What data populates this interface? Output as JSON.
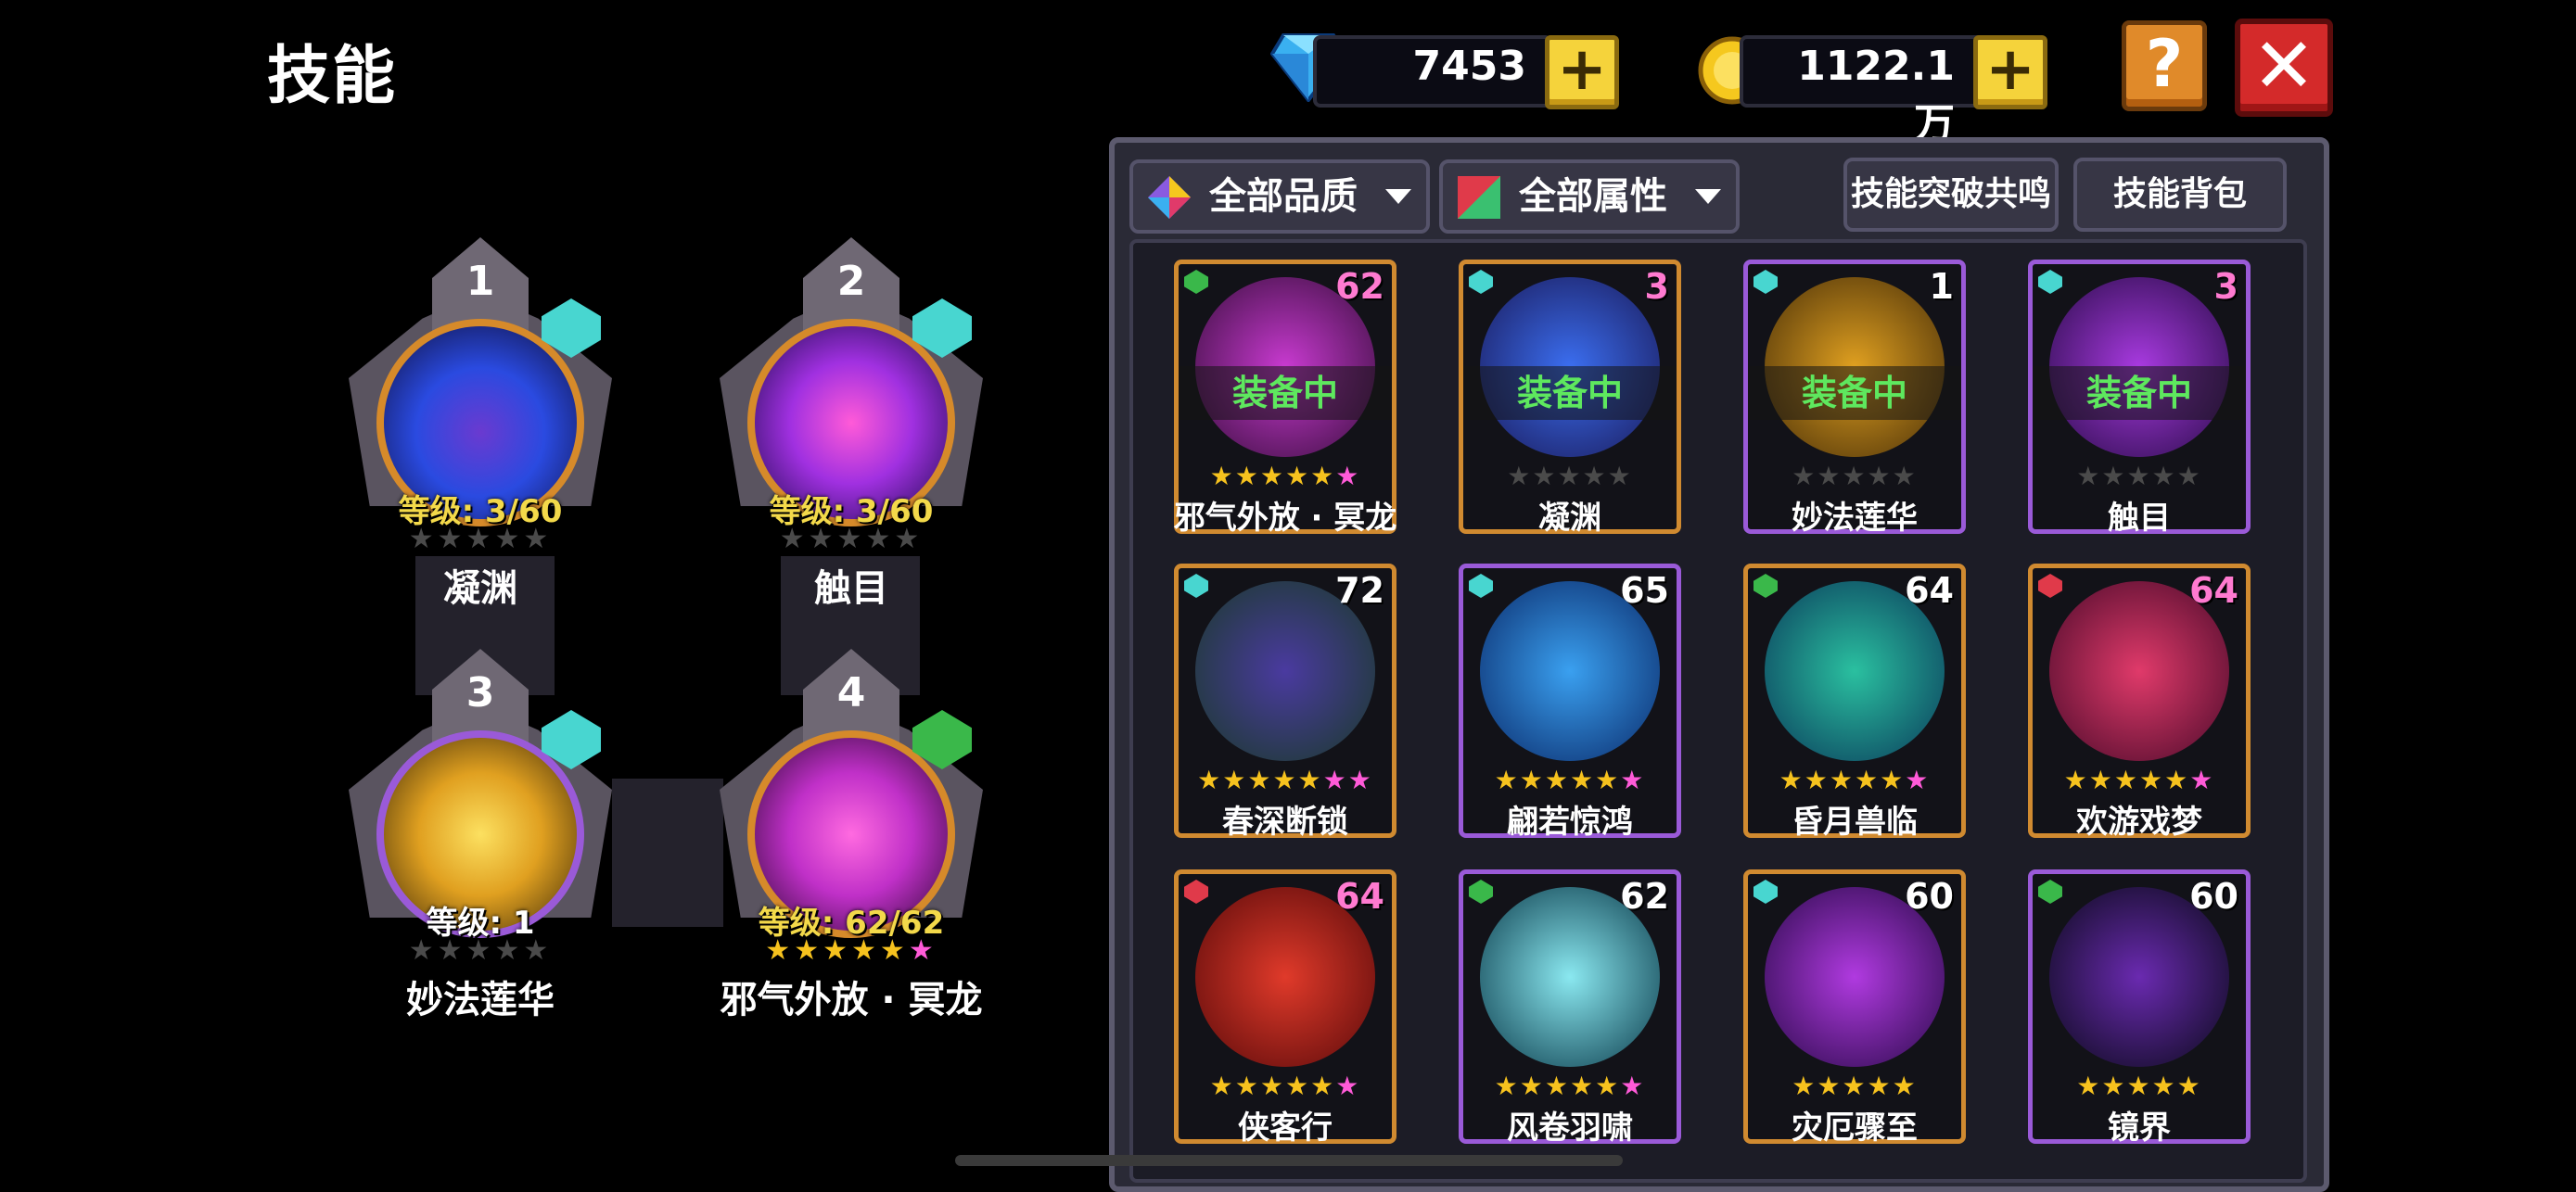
{
  "title": "技能",
  "currency": {
    "gems": "7453",
    "gold": "1122.1万",
    "plus_symbol": "+",
    "help_symbol": "?",
    "close_symbol": "✕"
  },
  "colors": {
    "gold_star": "#f6c21e",
    "pink_star": "#ff5ad8",
    "empty_star": "#4a4a4a",
    "equipped_text": "#5ee85e",
    "level_text": "#f3d94a",
    "orange_frame": "#d08a30",
    "purple_frame": "#9a5ad8"
  },
  "equipped": [
    {
      "slot": "1",
      "level": "等级: 3/60",
      "stars_gold": 0,
      "stars_pink": 0,
      "stars_total": 5,
      "name": "凝渊",
      "gem": "cyan",
      "orb": "blue-demon"
    },
    {
      "slot": "2",
      "level": "等级: 3/60",
      "stars_gold": 0,
      "stars_pink": 0,
      "stars_total": 5,
      "name": "触目",
      "gem": "cyan",
      "orb": "purple-swirl"
    },
    {
      "slot": "3",
      "level": "等级: 1",
      "stars_gold": 0,
      "stars_pink": 0,
      "stars_total": 5,
      "name": "妙法莲华",
      "gem": "cyan",
      "orb": "golden-lotus"
    },
    {
      "slot": "4",
      "level": "等级: 62/62",
      "stars_gold": 5,
      "stars_pink": 1,
      "stars_total": 6,
      "name": "邪气外放 · 冥龙",
      "gem": "green",
      "orb": "magenta-lotus"
    }
  ],
  "filters": {
    "quality": "全部品质",
    "attribute": "全部属性",
    "resonance": "技能突破共鸣",
    "backpack": "技能背包"
  },
  "cards": [
    {
      "name": "邪气外放 · 冥龙",
      "level": "62",
      "lvl_color": "#ff7ad0",
      "status": "装备中",
      "gold": 5,
      "pink": 1,
      "empty": 0,
      "frame": "orange",
      "gem": "green",
      "orb_colors": [
        "#c83ad0",
        "#3a0e3e"
      ]
    },
    {
      "name": "凝渊",
      "level": "3",
      "lvl_color": "#ff7ad0",
      "status": "装备中",
      "gold": 0,
      "pink": 0,
      "empty": 5,
      "frame": "orange",
      "gem": "cyan",
      "orb_colors": [
        "#3b6ef0",
        "#1a1a5a"
      ]
    },
    {
      "name": "妙法莲华",
      "level": "1",
      "lvl_color": "#ffffff",
      "status": "装备中",
      "gold": 0,
      "pink": 0,
      "empty": 5,
      "frame": "purple",
      "gem": "cyan",
      "orb_colors": [
        "#e0a020",
        "#4a3008"
      ]
    },
    {
      "name": "触目",
      "level": "3",
      "lvl_color": "#ff7ad0",
      "status": "装备中",
      "gold": 0,
      "pink": 0,
      "empty": 5,
      "frame": "purple",
      "gem": "cyan",
      "orb_colors": [
        "#a83ae0",
        "#2a0c4a"
      ]
    },
    {
      "name": "春深断锁",
      "level": "72",
      "lvl_color": "#ffffff",
      "status": "",
      "gold": 5,
      "pink": 2,
      "empty": 0,
      "frame": "orange",
      "gem": "cyan",
      "orb_colors": [
        "#4a3aa0",
        "#1a3a2a"
      ]
    },
    {
      "name": "翩若惊鸿",
      "level": "65",
      "lvl_color": "#ffffff",
      "status": "",
      "gold": 5,
      "pink": 1,
      "empty": 0,
      "frame": "purple",
      "gem": "cyan",
      "orb_colors": [
        "#3aa0f0",
        "#0a2a6a"
      ]
    },
    {
      "name": "昏月兽临",
      "level": "64",
      "lvl_color": "#ffffff",
      "status": "",
      "gold": 5,
      "pink": 1,
      "empty": 0,
      "frame": "orange",
      "gem": "green",
      "orb_colors": [
        "#2ac0a0",
        "#0a3a5a"
      ]
    },
    {
      "name": "欢游戏梦",
      "level": "64",
      "lvl_color": "#ff7ad0",
      "status": "",
      "gold": 5,
      "pink": 1,
      "empty": 0,
      "frame": "orange",
      "gem": "red",
      "orb_colors": [
        "#e03a6a",
        "#4a0a2a"
      ]
    },
    {
      "name": "侠客行",
      "level": "64",
      "lvl_color": "#ff7ad0",
      "status": "",
      "gold": 5,
      "pink": 1,
      "empty": 0,
      "frame": "orange",
      "gem": "red",
      "orb_colors": [
        "#e03a2a",
        "#5a0a0a"
      ]
    },
    {
      "name": "风卷羽啸",
      "level": "62",
      "lvl_color": "#ffffff",
      "status": "",
      "gold": 5,
      "pink": 1,
      "empty": 0,
      "frame": "purple",
      "gem": "green",
      "orb_colors": [
        "#8ae8f0",
        "#0a3a4a"
      ]
    },
    {
      "name": "灾厄骤至",
      "level": "60",
      "lvl_color": "#ffffff",
      "status": "",
      "gold": 5,
      "pink": 0,
      "empty": 0,
      "frame": "orange",
      "gem": "cyan",
      "orb_colors": [
        "#b03ae0",
        "#2a0a4a"
      ]
    },
    {
      "name": "镜界",
      "level": "60",
      "lvl_color": "#ffffff",
      "status": "",
      "gold": 5,
      "pink": 0,
      "empty": 0,
      "frame": "purple",
      "gem": "green",
      "orb_colors": [
        "#6a2ab0",
        "#0a0a1a"
      ]
    }
  ]
}
